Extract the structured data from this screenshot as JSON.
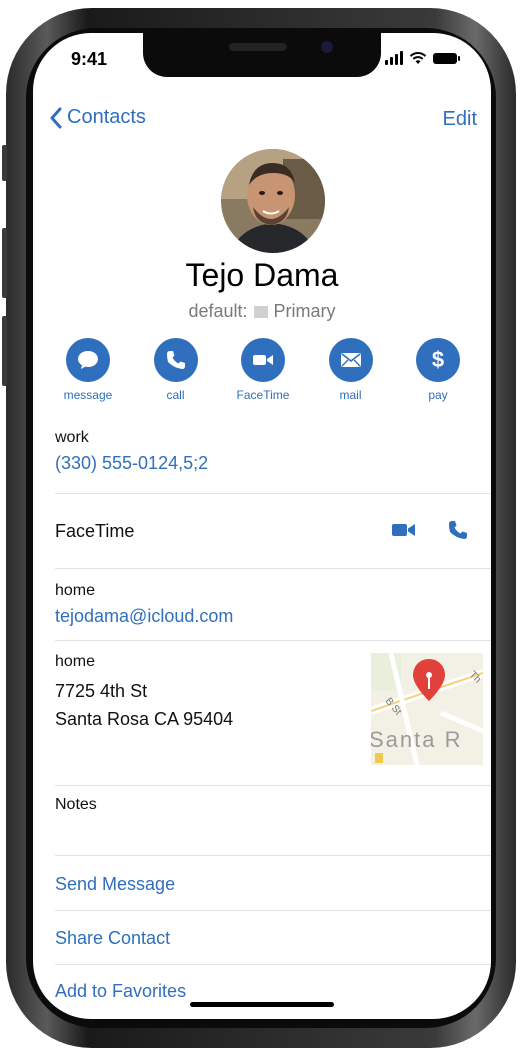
{
  "status_bar": {
    "time": "9:41"
  },
  "nav": {
    "back_label": "Contacts",
    "edit_label": "Edit"
  },
  "contact": {
    "name": "Tejo Dama",
    "account_label": "default:",
    "account_name": "Primary"
  },
  "actions": [
    {
      "label": "message",
      "icon": "message-bubble-icon"
    },
    {
      "label": "call",
      "icon": "phone-icon"
    },
    {
      "label": "FaceTime",
      "icon": "video-camera-icon"
    },
    {
      "label": "mail",
      "icon": "envelope-icon"
    },
    {
      "label": "pay",
      "icon": "dollar-icon"
    }
  ],
  "phone": {
    "label": "work",
    "value": "(330) 555-0124,5;2"
  },
  "facetime": {
    "label": "FaceTime"
  },
  "email": {
    "label": "home",
    "value": "tejodama@icloud.com"
  },
  "address": {
    "label": "home",
    "line1": "7725 4th St",
    "line2": "Santa Rosa CA 95404",
    "map_text": "Santa R",
    "map_street_1": "B St",
    "map_street_2": "Th"
  },
  "notes": {
    "label": "Notes"
  },
  "links": {
    "send_message": "Send Message",
    "share_contact": "Share Contact",
    "add_favorites": "Add to Favorites"
  },
  "colors": {
    "accent": "#2f6fbd",
    "map_pin": "#e0413a"
  }
}
